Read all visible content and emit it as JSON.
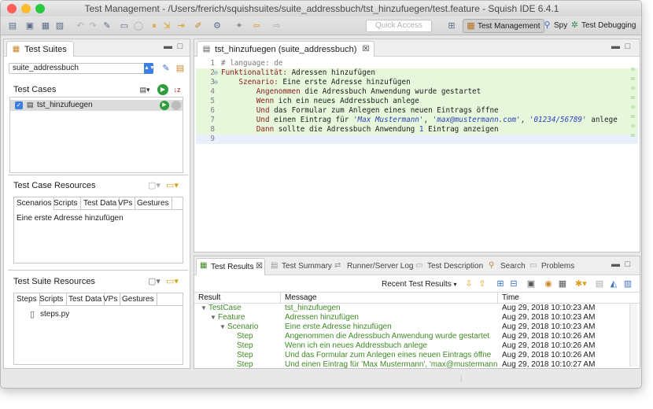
{
  "window": {
    "title": "Test Management - /Users/frerich/squishsuites/suite_addressbuch/tst_hinzufuegen/test.feature - Squish IDE 6.4.1"
  },
  "toolbar": {
    "quick_access_placeholder": "Quick Access",
    "perspectives": [
      {
        "label": "Test Management",
        "icon": "test-management-icon"
      },
      {
        "label": "Spy",
        "icon": "spy-icon"
      },
      {
        "label": "Test Debugging",
        "icon": "debug-icon"
      }
    ]
  },
  "suites_panel": {
    "tab_label": "Test Suites",
    "suite_selected": "suite_addressbuch",
    "test_cases_label": "Test Cases",
    "test_cases": [
      {
        "name": "tst_hinzufuegen",
        "checked": true
      }
    ],
    "resources_label": "Test Case Resources",
    "resource_tabs": [
      "Scenarios",
      "Scripts",
      "Test Data",
      "VPs",
      "Gestures"
    ],
    "scenarios": [
      "Eine erste Adresse hinzufügen"
    ],
    "suite_resources_label": "Test Suite Resources",
    "suite_resource_tabs": [
      "Steps",
      "Scripts",
      "Test Data",
      "VPs",
      "Gestures"
    ],
    "steps_files": [
      "steps.py"
    ]
  },
  "editor": {
    "tab_label": "tst_hinzufuegen (suite_addressbuch)",
    "lines": [
      {
        "n": "1",
        "fold": "",
        "parts": [
          {
            "t": "# language: de",
            "c": "cmt"
          }
        ]
      },
      {
        "n": "2",
        "fold": "⊖",
        "parts": [
          {
            "t": "Funktionalität:",
            "c": "kw"
          },
          {
            "t": " Adressen hinzufügen",
            "c": ""
          }
        ]
      },
      {
        "n": "3",
        "fold": "⊖",
        "parts": [
          {
            "t": "    Szenario:",
            "c": "kw"
          },
          {
            "t": " Eine erste Adresse hinzufügen",
            "c": ""
          }
        ]
      },
      {
        "n": "4",
        "fold": "",
        "parts": [
          {
            "t": "        Angenommen",
            "c": "kw"
          },
          {
            "t": " die Adressbuch Anwendung wurde gestartet",
            "c": ""
          }
        ]
      },
      {
        "n": "5",
        "fold": "",
        "parts": [
          {
            "t": "        Wenn",
            "c": "kw"
          },
          {
            "t": " ich ein neues Addressbuch anlege",
            "c": ""
          }
        ]
      },
      {
        "n": "6",
        "fold": "",
        "parts": [
          {
            "t": "        Und",
            "c": "kw"
          },
          {
            "t": " das Formular zum Anlegen eines neuen Eintrags öffne",
            "c": ""
          }
        ]
      },
      {
        "n": "7",
        "fold": "",
        "parts": [
          {
            "t": "        Und",
            "c": "kw"
          },
          {
            "t": " einen Eintrag für ",
            "c": ""
          },
          {
            "t": "'Max Mustermann'",
            "c": "str"
          },
          {
            "t": ", ",
            "c": ""
          },
          {
            "t": "'max@mustermann.com'",
            "c": "str"
          },
          {
            "t": ", ",
            "c": ""
          },
          {
            "t": "'01234/56789'",
            "c": "str"
          },
          {
            "t": " anlege",
            "c": ""
          }
        ]
      },
      {
        "n": "8",
        "fold": "",
        "parts": [
          {
            "t": "        Dann",
            "c": "kw"
          },
          {
            "t": " sollte die Adressbuch Anwendung ",
            "c": ""
          },
          {
            "t": "1",
            "c": "num"
          },
          {
            "t": " Eintrag anzeigen",
            "c": ""
          }
        ]
      },
      {
        "n": "9",
        "fold": "",
        "parts": [
          {
            "t": "",
            "c": ""
          }
        ]
      }
    ]
  },
  "results": {
    "tabs": [
      {
        "label": "Test Results",
        "active": true
      },
      {
        "label": "Test Summary",
        "active": false
      },
      {
        "label": "Runner/Server Log",
        "active": false
      },
      {
        "label": "Test Description",
        "active": false
      },
      {
        "label": "Search",
        "active": false
      },
      {
        "label": "Problems",
        "active": false
      }
    ],
    "recent_label": "Recent Test Results",
    "columns": [
      "Result",
      "Message",
      "Time"
    ],
    "rows": [
      {
        "indent": 0,
        "arrow": "▼",
        "result": "TestCase",
        "message": "tst_hinzufuegen",
        "time": "Aug 29, 2018 10:10:23 AM"
      },
      {
        "indent": 1,
        "arrow": "▼",
        "result": "Feature",
        "message": "Adressen hinzufügen",
        "time": "Aug 29, 2018 10:10:23 AM"
      },
      {
        "indent": 2,
        "arrow": "▼",
        "result": "Scenario",
        "message": "Eine erste Adresse hinzufügen",
        "time": "Aug 29, 2018 10:10:23 AM"
      },
      {
        "indent": 3,
        "arrow": "",
        "result": "Step",
        "message": "Angenommen die Adressbuch Anwendung wurde gestartet",
        "time": "Aug 29, 2018 10:10:26 AM"
      },
      {
        "indent": 3,
        "arrow": "",
        "result": "Step",
        "message": "Wenn ich ein neues Addressbuch anlege",
        "time": "Aug 29, 2018 10:10:26 AM"
      },
      {
        "indent": 3,
        "arrow": "",
        "result": "Step",
        "message": "Und das Formular zum Anlegen eines neuen Eintrags öffne",
        "time": "Aug 29, 2018 10:10:26 AM"
      },
      {
        "indent": 3,
        "arrow": "",
        "result": "Step",
        "message": "Und einen Eintrag für 'Max Mustermann', 'max@mustermann...",
        "time": "Aug 29, 2018 10:10:27 AM"
      }
    ]
  }
}
